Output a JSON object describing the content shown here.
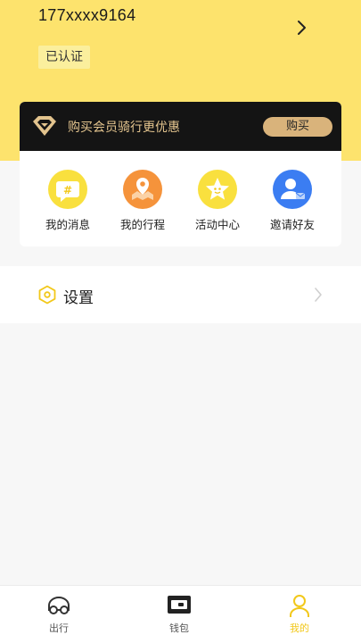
{
  "header": {
    "phone": "177xxxx9164",
    "verified_badge": "已认证"
  },
  "vip": {
    "text": "购买会员骑行更优惠",
    "buy_label": "购买"
  },
  "menu": [
    {
      "label": "我的消息",
      "icon": "message-hash-icon"
    },
    {
      "label": "我的行程",
      "icon": "map-pin-icon"
    },
    {
      "label": "活动中心",
      "icon": "star-icon"
    },
    {
      "label": "邀请好友",
      "icon": "invite-user-icon"
    }
  ],
  "settings": {
    "label": "设置",
    "icon": "hexagon-settings-icon"
  },
  "tabbar": {
    "items": [
      {
        "label": "出行",
        "icon": "scooter-icon"
      },
      {
        "label": "钱包",
        "icon": "wallet-icon"
      },
      {
        "label": "我的",
        "icon": "user-icon",
        "active": true
      }
    ]
  },
  "colors": {
    "header_bg": "#fde36d",
    "vip_bar_bg": "#141414",
    "vip_gold": "#d9b37b",
    "active_tab": "#f2c81a",
    "msg_icon": "#f9e03e",
    "trip_icon": "#f5933b",
    "invite_icon": "#3b7df2"
  }
}
